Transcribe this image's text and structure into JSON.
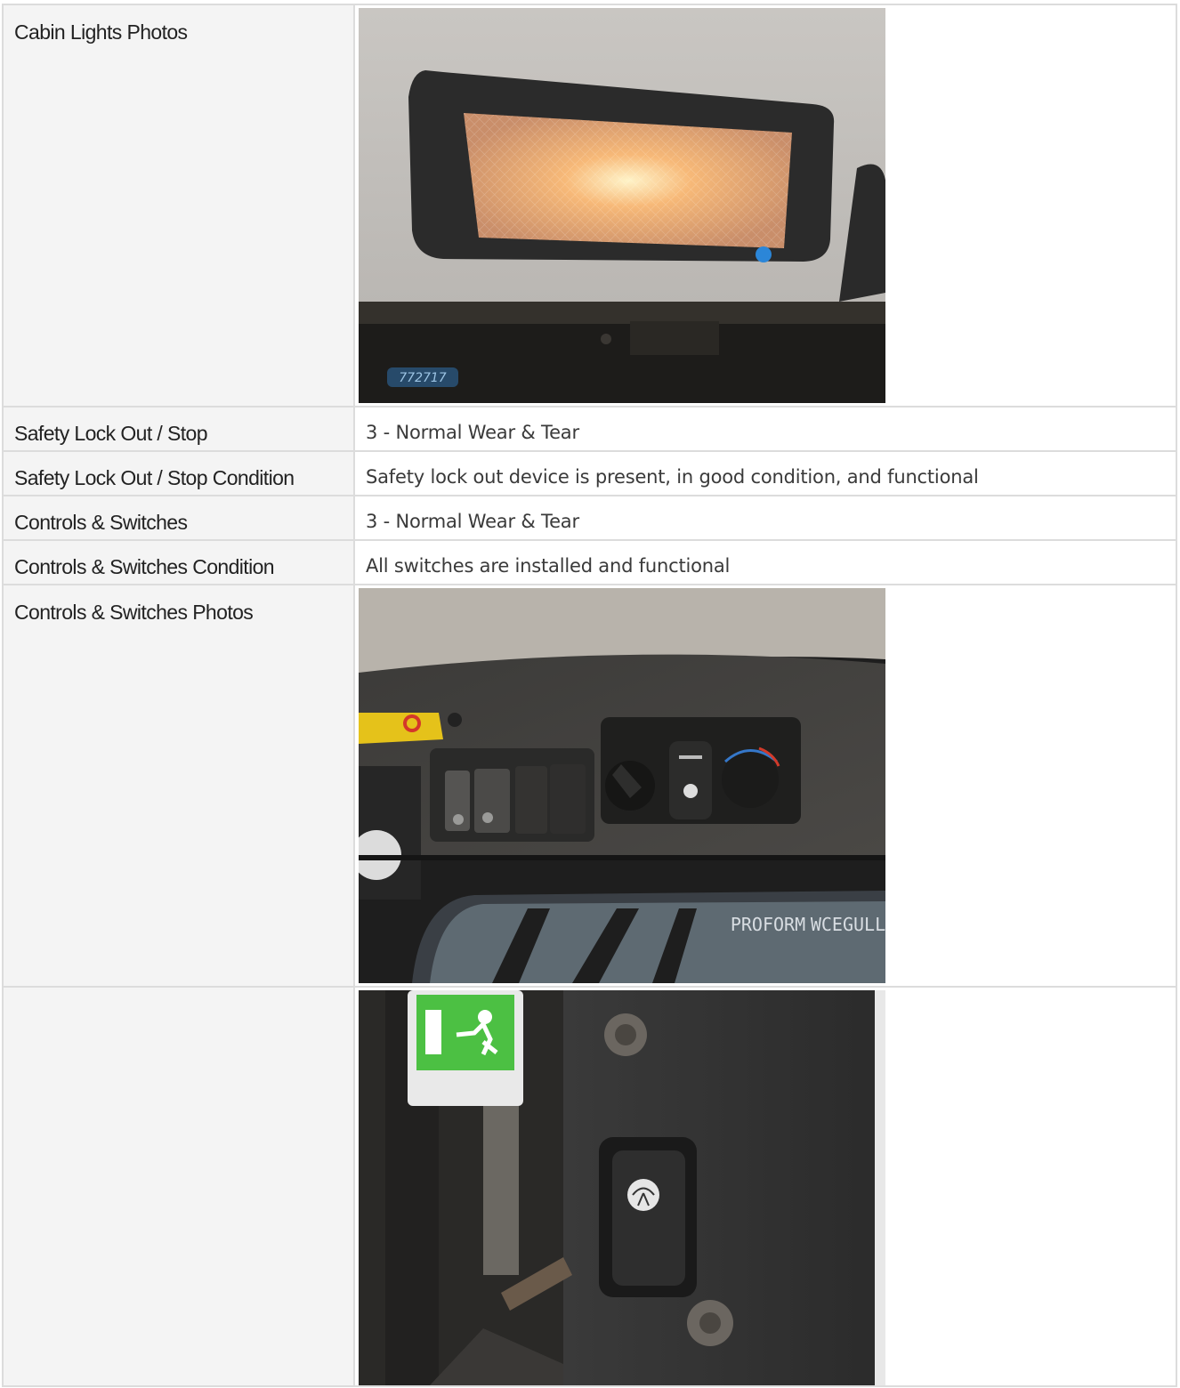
{
  "rows": [
    {
      "label": "Cabin Lights Photos",
      "type": "photo",
      "photo": "cabin-light"
    },
    {
      "label": "Safety Lock Out / Stop",
      "type": "text",
      "value": "3 - Normal Wear & Tear"
    },
    {
      "label": "Safety Lock Out / Stop Condition",
      "type": "text",
      "value": "Safety lock out device is present, in good condition, and functional"
    },
    {
      "label": "Controls & Switches",
      "type": "text",
      "value": "3 - Normal Wear & Tear"
    },
    {
      "label": "Controls & Switches Condition",
      "type": "text",
      "value": "All switches are installed and functional"
    },
    {
      "label": "Controls & Switches Photos",
      "type": "photo",
      "photo": "switch-panel"
    },
    {
      "label": "",
      "type": "photo",
      "photo": "wiper-switch"
    }
  ],
  "photo_text": {
    "cabin_light_tag": "772717",
    "panel_sign_1": "PROFORM",
    "panel_sign_2": "WCEGULL"
  },
  "colors": {
    "label_bg": "#f4f4f4",
    "border": "#dcdcdc",
    "text": "#333333"
  }
}
